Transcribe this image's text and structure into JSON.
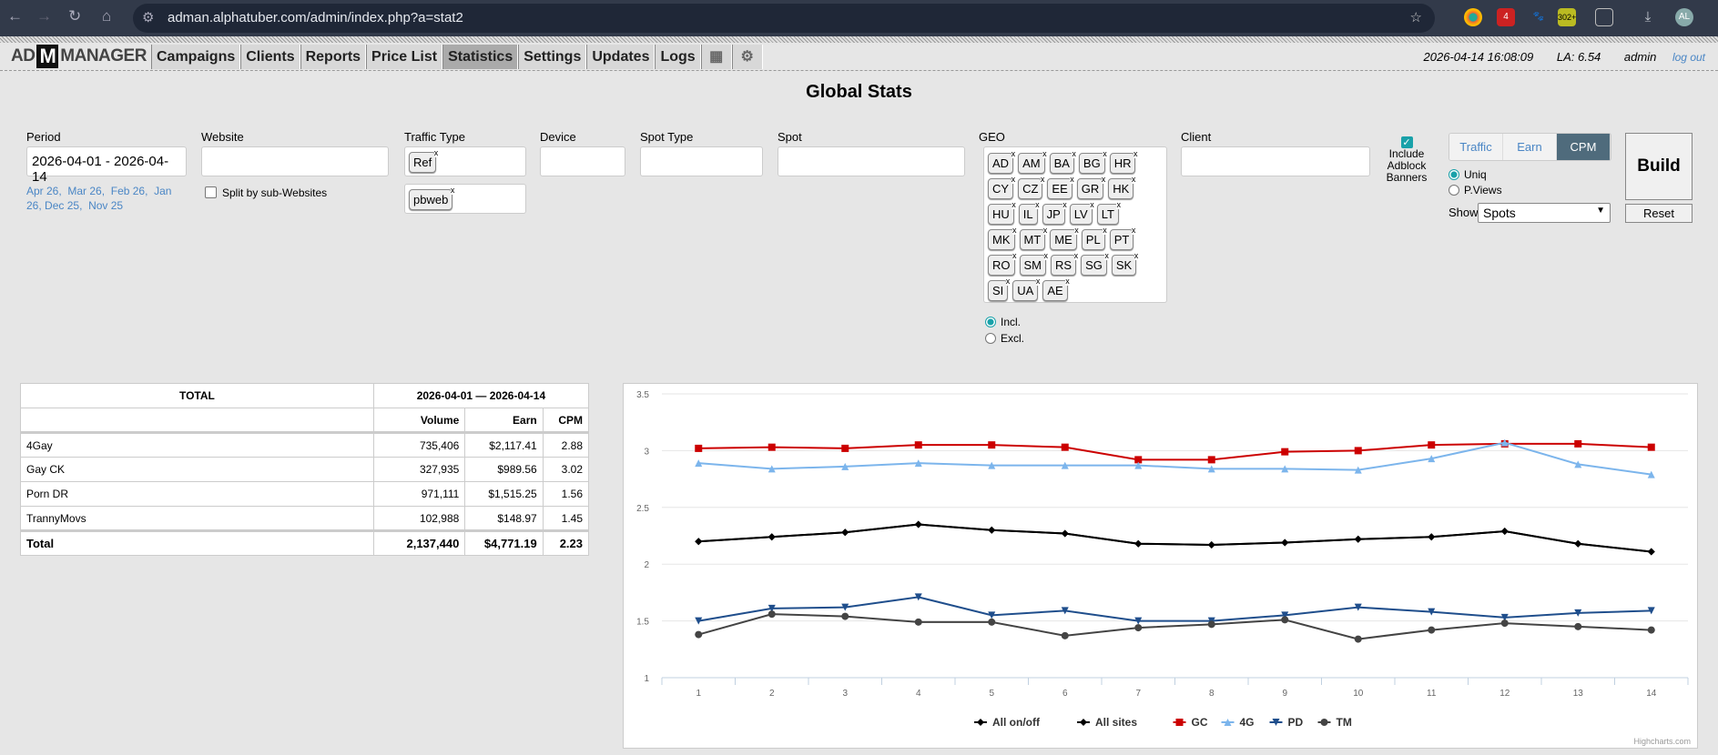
{
  "browser": {
    "url": "adman.alphatuber.com/admin/index.php?a=stat2",
    "ext_badges": [
      "4",
      "302+"
    ],
    "profile": "AL"
  },
  "nav": {
    "logo_left": "AD",
    "logo_m": "M",
    "logo_right": "MANAGER",
    "items": [
      "Campaigns",
      "Clients",
      "Reports",
      "Price List",
      "Statistics",
      "Settings",
      "Updates",
      "Logs"
    ],
    "active": "Statistics",
    "datetime": "2026-04-14 16:08:09",
    "la": "LA: 6.54",
    "user": "admin",
    "logout": "log out"
  },
  "page_title": "Global Stats",
  "filters": {
    "period": {
      "label": "Period",
      "value": "2026-04-01 - 2026-04-14",
      "quick": [
        "Apr 26",
        "Mar 26",
        "Feb 26",
        "Jan 26",
        "Dec 25",
        "Nov 25"
      ]
    },
    "website": {
      "label": "Website",
      "value": "",
      "split_label": "Split by sub-Websites",
      "split_checked": false
    },
    "traffic_type": {
      "label": "Traffic Type",
      "tags": [
        "Ref"
      ],
      "tags2": [
        "pbweb"
      ]
    },
    "device": {
      "label": "Device",
      "value": ""
    },
    "spot_type": {
      "label": "Spot Type",
      "value": ""
    },
    "spot": {
      "label": "Spot",
      "value": ""
    },
    "geo": {
      "label": "GEO",
      "tags": [
        "AD",
        "AM",
        "BA",
        "BG",
        "HR",
        "CY",
        "CZ",
        "EE",
        "GR",
        "HK",
        "HU",
        "IL",
        "JP",
        "LV",
        "LT",
        "MK",
        "MT",
        "ME",
        "PL",
        "PT",
        "RO",
        "SM",
        "RS",
        "SG",
        "SK",
        "SI",
        "UA",
        "AE"
      ],
      "incl": "Incl.",
      "excl": "Excl.",
      "mode": "Incl."
    },
    "client": {
      "label": "Client",
      "value": ""
    },
    "adblock": {
      "label": "Include Adblock Banners",
      "checked": true
    },
    "metric_tabs": [
      "Traffic",
      "Earn",
      "CPM"
    ],
    "metric_active": "CPM",
    "count_mode": {
      "uniq": "Uniq",
      "pviews": "P.Views",
      "selected": "Uniq"
    },
    "show": {
      "label": "Show",
      "value": "Spots"
    },
    "build": "Build",
    "reset": "Reset"
  },
  "table": {
    "header_total": "TOTAL",
    "header_period": "2026-04-01 — 2026-04-14",
    "columns": [
      "Volume",
      "Earn",
      "CPM"
    ],
    "rows": [
      {
        "name": "4Gay",
        "volume": "735,406",
        "earn": "$2,117.41",
        "cpm": "2.88"
      },
      {
        "name": "Gay CK",
        "volume": "327,935",
        "earn": "$989.56",
        "cpm": "3.02"
      },
      {
        "name": "Porn DR",
        "volume": "971,111",
        "earn": "$1,515.25",
        "cpm": "1.56"
      },
      {
        "name": "TrannyMovs",
        "volume": "102,988",
        "earn": "$148.97",
        "cpm": "1.45"
      }
    ],
    "total": {
      "name": "Total",
      "volume": "2,137,440",
      "earn": "$4,771.19",
      "cpm": "2.23"
    }
  },
  "chart_data": {
    "type": "line",
    "x": [
      1,
      2,
      3,
      4,
      5,
      6,
      7,
      8,
      9,
      10,
      11,
      12,
      13,
      14
    ],
    "ylim": [
      1,
      3.5
    ],
    "yticks": [
      1,
      1.5,
      2,
      2.5,
      3,
      3.5
    ],
    "grid": true,
    "legend": "bottom",
    "credit": "Highcharts.com",
    "series": [
      {
        "name": "All on/off",
        "color": "#000000",
        "marker": "diamond",
        "values": [
          2.2,
          2.24,
          2.28,
          2.35,
          2.3,
          2.27,
          2.18,
          2.17,
          2.19,
          2.22,
          2.24,
          2.29,
          2.18,
          2.11
        ]
      },
      {
        "name": "All sites",
        "color": "#000000",
        "marker": "diamond",
        "values": [
          2.2,
          2.24,
          2.28,
          2.35,
          2.3,
          2.27,
          2.18,
          2.17,
          2.19,
          2.22,
          2.24,
          2.29,
          2.18,
          2.11
        ]
      },
      {
        "name": "GC",
        "color": "#cc0000",
        "marker": "square",
        "values": [
          3.02,
          3.03,
          3.02,
          3.05,
          3.05,
          3.03,
          2.92,
          2.92,
          2.99,
          3.0,
          3.05,
          3.06,
          3.06,
          3.03
        ]
      },
      {
        "name": "4G",
        "color": "#7cb5ec",
        "marker": "triangle",
        "values": [
          2.89,
          2.84,
          2.86,
          2.89,
          2.87,
          2.87,
          2.87,
          2.84,
          2.84,
          2.83,
          2.93,
          3.07,
          2.88,
          2.79
        ]
      },
      {
        "name": "PD",
        "color": "#1f4e8c",
        "marker": "triangle-down",
        "values": [
          1.5,
          1.61,
          1.62,
          1.71,
          1.55,
          1.59,
          1.5,
          1.5,
          1.55,
          1.62,
          1.58,
          1.53,
          1.57,
          1.59
        ]
      },
      {
        "name": "TM",
        "color": "#444444",
        "marker": "circle",
        "values": [
          1.38,
          1.56,
          1.54,
          1.49,
          1.49,
          1.37,
          1.44,
          1.47,
          1.51,
          1.34,
          1.42,
          1.48,
          1.45,
          1.42
        ]
      }
    ]
  }
}
